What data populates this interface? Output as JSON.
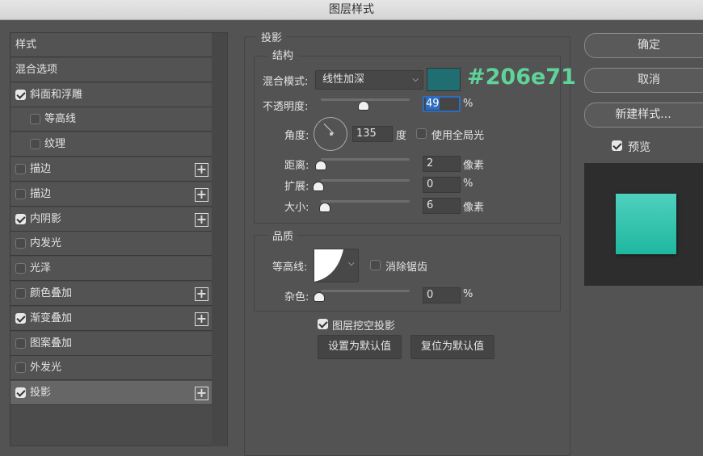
{
  "window": {
    "title": "图层样式"
  },
  "styles_list": [
    {
      "label": "样式",
      "checkbox": null,
      "plus": false,
      "indent": false
    },
    {
      "label": "混合选项",
      "checkbox": null,
      "plus": false,
      "indent": false
    },
    {
      "label": "斜面和浮雕",
      "checkbox": true,
      "plus": false,
      "indent": false
    },
    {
      "label": "等高线",
      "checkbox": false,
      "plus": false,
      "indent": true
    },
    {
      "label": "纹理",
      "checkbox": false,
      "plus": false,
      "indent": true
    },
    {
      "label": "描边",
      "checkbox": false,
      "plus": true,
      "indent": false
    },
    {
      "label": "描边",
      "checkbox": false,
      "plus": true,
      "indent": false
    },
    {
      "label": "内阴影",
      "checkbox": true,
      "plus": true,
      "indent": false
    },
    {
      "label": "内发光",
      "checkbox": false,
      "plus": false,
      "indent": false
    },
    {
      "label": "光泽",
      "checkbox": false,
      "plus": false,
      "indent": false
    },
    {
      "label": "颜色叠加",
      "checkbox": false,
      "plus": true,
      "indent": false
    },
    {
      "label": "渐变叠加",
      "checkbox": true,
      "plus": true,
      "indent": false
    },
    {
      "label": "图案叠加",
      "checkbox": false,
      "plus": false,
      "indent": false
    },
    {
      "label": "外发光",
      "checkbox": false,
      "plus": false,
      "indent": false
    },
    {
      "label": "投影",
      "checkbox": true,
      "plus": true,
      "indent": false,
      "selected": true
    }
  ],
  "panel": {
    "title": "投影",
    "structure": {
      "title": "结构",
      "blend_mode_label": "混合模式:",
      "blend_mode": "线性加深",
      "color": "#206e71",
      "color_annotation": "#206e71",
      "opacity_label": "不透明度:",
      "opacity": "49",
      "opacity_unit": "%",
      "angle_label": "角度:",
      "angle": "135",
      "angle_unit": "度",
      "global_light_label": "使用全局光",
      "global_light": false,
      "distance_label": "距离:",
      "distance": "2",
      "distance_unit": "像素",
      "spread_label": "扩展:",
      "spread": "0",
      "spread_unit": "%",
      "size_label": "大小:",
      "size": "6",
      "size_unit": "像素"
    },
    "quality": {
      "title": "品质",
      "contour_label": "等高线:",
      "antialias_label": "消除锯齿",
      "antialias": false,
      "noise_label": "杂色:",
      "noise": "0",
      "noise_unit": "%"
    },
    "knockout_label": "图层挖空投影",
    "knockout": true,
    "set_default": "设置为默认值",
    "reset_default": "复位为默认值"
  },
  "buttons": {
    "ok": "确定",
    "cancel": "取消",
    "new_style": "新建样式...",
    "preview_label": "预览",
    "preview": true
  },
  "colors": {
    "annotation": "#5fd39a",
    "preview_top": "#4fd0bf",
    "preview_bottom": "#1fb79f"
  }
}
